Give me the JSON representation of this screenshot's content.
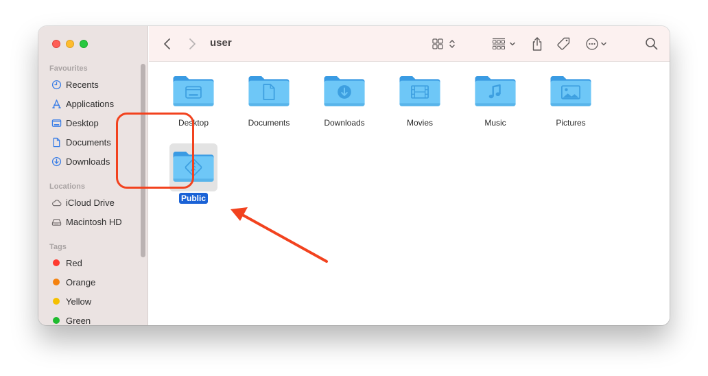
{
  "window": {
    "title": "user",
    "traffic_lights": [
      "close",
      "minimize",
      "maximize"
    ]
  },
  "sidebar": {
    "sections": [
      {
        "title": "Favourites",
        "items": [
          {
            "label": "Recents",
            "icon": "clock-icon"
          },
          {
            "label": "Applications",
            "icon": "applications-icon"
          },
          {
            "label": "Desktop",
            "icon": "desktop-icon"
          },
          {
            "label": "Documents",
            "icon": "document-icon"
          },
          {
            "label": "Downloads",
            "icon": "download-icon"
          }
        ]
      },
      {
        "title": "Locations",
        "items": [
          {
            "label": "iCloud Drive",
            "icon": "cloud-icon"
          },
          {
            "label": "Macintosh HD",
            "icon": "hard-drive-icon"
          }
        ]
      },
      {
        "title": "Tags",
        "items": [
          {
            "label": "Red",
            "color": "#fe3b30"
          },
          {
            "label": "Orange",
            "color": "#f4820f"
          },
          {
            "label": "Yellow",
            "color": "#f5c000"
          },
          {
            "label": "Green",
            "color": "#1fbb2f"
          }
        ]
      }
    ]
  },
  "toolbar": {
    "back": "back-icon",
    "forward": "forward-icon",
    "title": "user",
    "view_mode": "icon-view-icon",
    "group": "group-icon",
    "share": "share-icon",
    "tag": "tag-icon",
    "more": "more-icon",
    "search": "search-icon"
  },
  "folders": [
    {
      "name": "Desktop",
      "glyph": "desktop",
      "selected": false
    },
    {
      "name": "Documents",
      "glyph": "document",
      "selected": false
    },
    {
      "name": "Downloads",
      "glyph": "download",
      "selected": false
    },
    {
      "name": "Movies",
      "glyph": "film",
      "selected": false
    },
    {
      "name": "Music",
      "glyph": "music",
      "selected": false
    },
    {
      "name": "Pictures",
      "glyph": "picture",
      "selected": false
    },
    {
      "name": "Public",
      "glyph": "public",
      "selected": true
    }
  ],
  "annotation": {
    "color": "#f2421e",
    "target": "Public"
  },
  "colors": {
    "folder_body": "#6ec7f7",
    "folder_back": "#3a9be3",
    "folder_glyph": "#3d9fe0",
    "selection": "#1a62d6"
  }
}
